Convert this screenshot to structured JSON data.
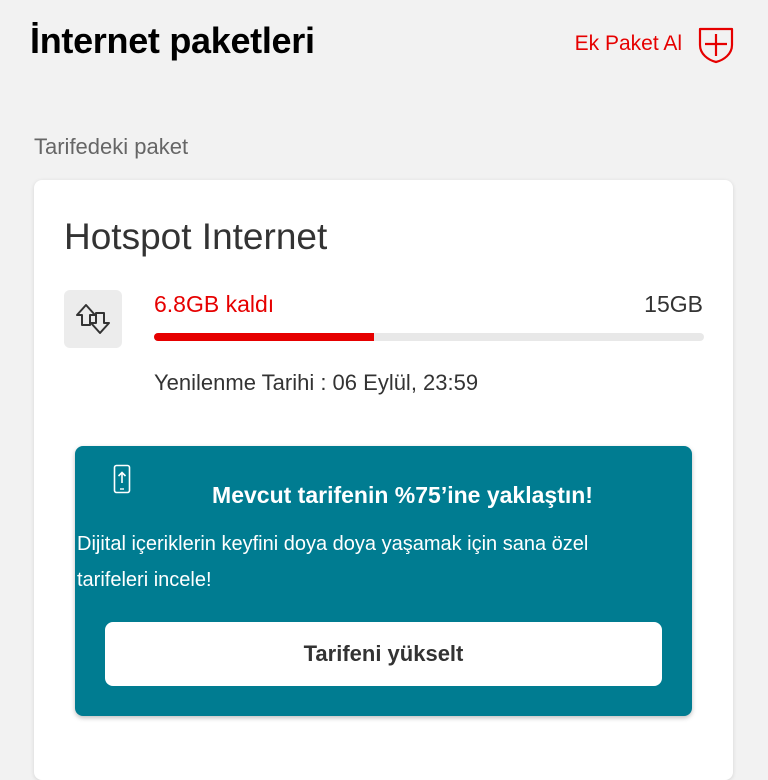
{
  "header": {
    "title": "İnternet paketleri",
    "add_package_label": "Ek Paket Al",
    "add_package_icon": "plus-shield-icon",
    "accent_color": "#e60000"
  },
  "section": {
    "label": "Tarifedeki paket"
  },
  "package": {
    "name": "Hotspot Internet",
    "icon": "data-transfer-arrows-icon",
    "remaining_label": "6.8GB kaldı",
    "total_label": "15GB",
    "remaining_fraction": 0.4,
    "renewal_label": "Yenilenme Tarihi : 06 Eylül, 23:59"
  },
  "banner": {
    "icon": "phone-upload-icon",
    "headline": "Mevcut tarifenin %75’ine yaklaştın!",
    "description": "Dijital içeriklerin keyfini doya doya yaşamak için sana özel tarifeleri incele!",
    "button_label": "Tarifeni yükselt",
    "background_color": "#007c91"
  }
}
